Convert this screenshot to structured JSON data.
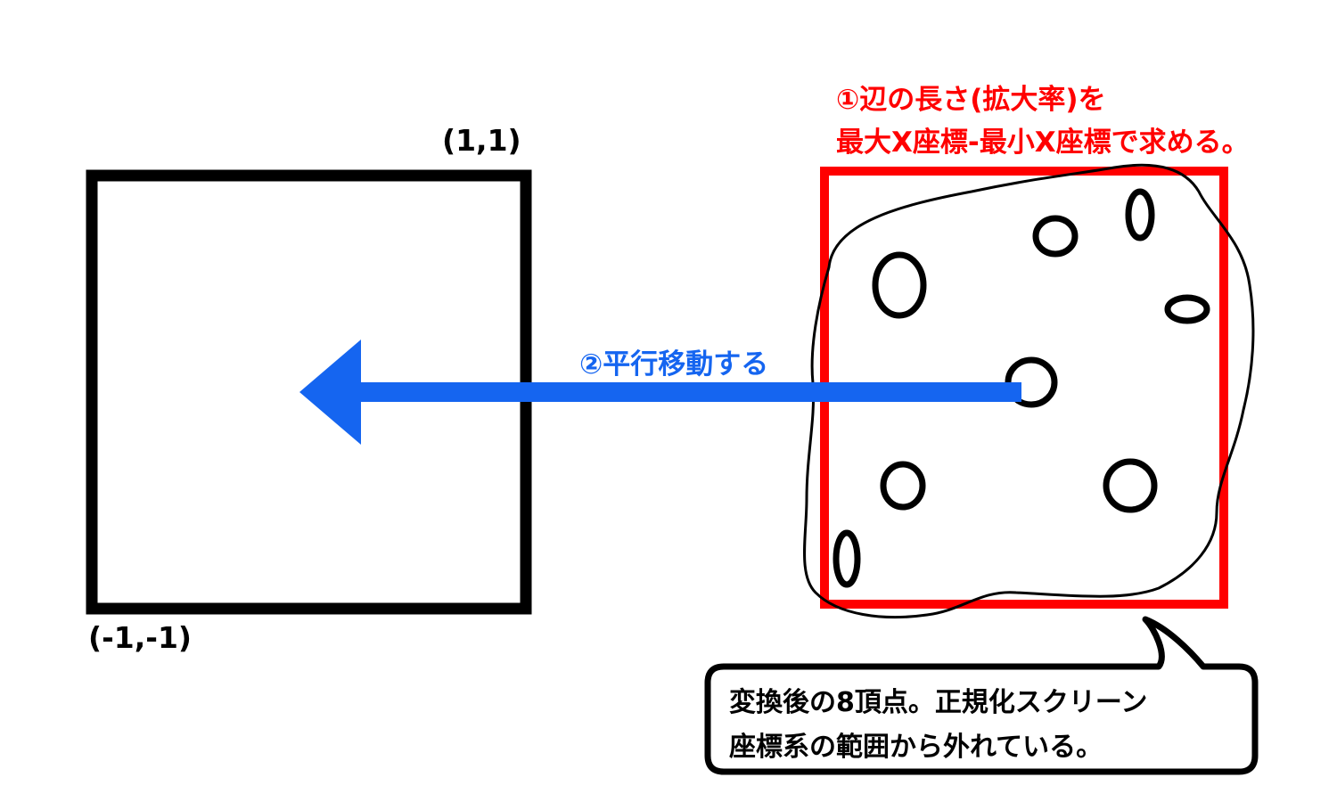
{
  "square_label_top_right": "(1,1)",
  "square_label_bottom_left": "(-1,-1)",
  "annotation_scale": {
    "line1": "①辺の長さ(拡大率)を",
    "line2": "最大X座標-最小X座標で求める。"
  },
  "annotation_translate": "②平行移動する",
  "callout": {
    "line1": "変換後の8頂点。正規化スクリーン",
    "line2": "座標系の範囲から外れている。"
  },
  "colors": {
    "square": "#000000",
    "bounding_box": "#ff0000",
    "arrow": "#1565f0",
    "scale_text": "#ff0000"
  }
}
